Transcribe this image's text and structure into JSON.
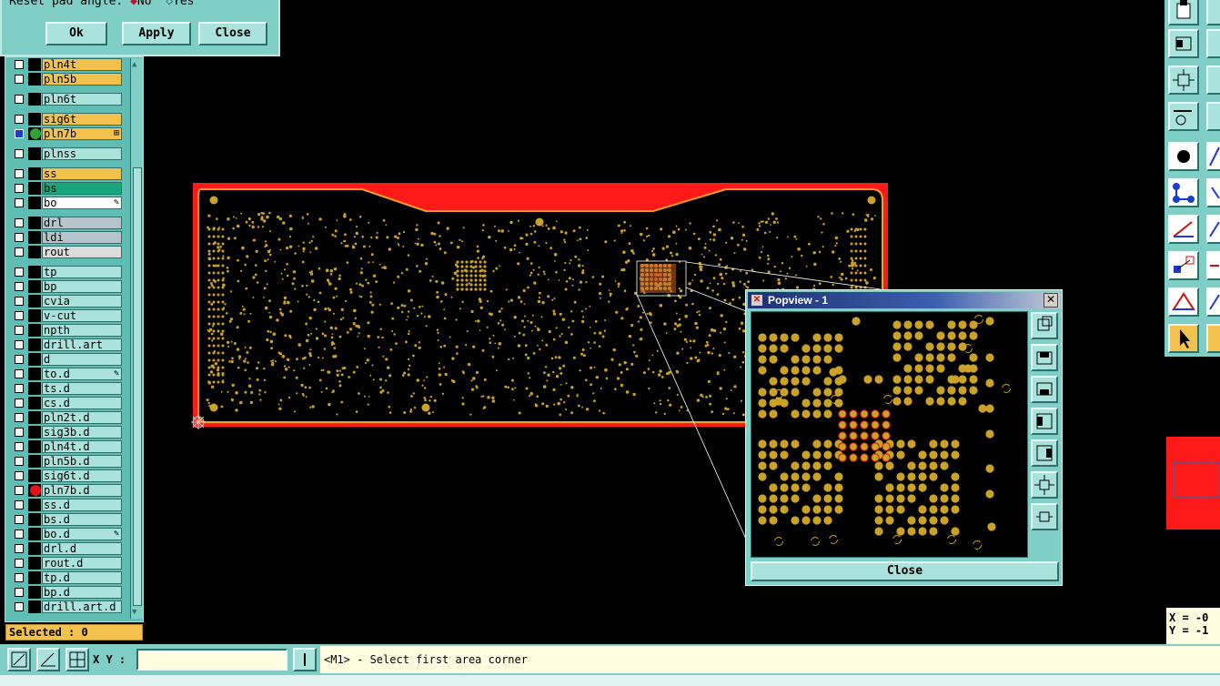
{
  "dialog": {
    "reset_label": "Reset pad angle:",
    "opt_no": "No",
    "opt_yes": "Yes",
    "ok": "Ok",
    "apply": "Apply",
    "close": "Close"
  },
  "layers": [
    {
      "name": "pln4t",
      "color": "#f2c14e"
    },
    {
      "name": "pln5b",
      "color": "#f2c14e"
    },
    {
      "name": "pln6t",
      "color": "#a9e3dc"
    },
    {
      "name": "sig6t",
      "color": "#f2c14e"
    },
    {
      "name": "pln7b",
      "color": "#f2c14e",
      "dot": "#2fa33a",
      "marker": "⊞",
      "checked": true
    },
    {
      "name": "plnss",
      "color": "#a9e3dc"
    },
    {
      "name": "ss",
      "color": "#f2c14e"
    },
    {
      "name": "bs",
      "color": "#1aa57c"
    },
    {
      "name": "bo",
      "color": "#ffffff",
      "marker": "✎"
    },
    {
      "name": "drl",
      "color": "#b7c4cc"
    },
    {
      "name": "ldi",
      "color": "#b7c4cc"
    },
    {
      "name": "rout",
      "color": "#dcdcdc"
    },
    {
      "name": "tp",
      "color": "#a9e3dc"
    },
    {
      "name": "bp",
      "color": "#a9e3dc"
    },
    {
      "name": "cvia",
      "color": "#a9e3dc"
    },
    {
      "name": "v-cut",
      "color": "#a9e3dc"
    },
    {
      "name": "npth",
      "color": "#a9e3dc"
    },
    {
      "name": "drill.art",
      "color": "#a9e3dc"
    },
    {
      "name": "d",
      "color": "#a9e3dc"
    },
    {
      "name": "to.d",
      "color": "#a9e3dc",
      "marker": "✎"
    },
    {
      "name": "ts.d",
      "color": "#a9e3dc"
    },
    {
      "name": "cs.d",
      "color": "#a9e3dc"
    },
    {
      "name": "pln2t.d",
      "color": "#a9e3dc"
    },
    {
      "name": "sig3b.d",
      "color": "#a9e3dc"
    },
    {
      "name": "pln4t.d",
      "color": "#a9e3dc"
    },
    {
      "name": "pln5b.d",
      "color": "#a9e3dc"
    },
    {
      "name": "sig6t.d",
      "color": "#a9e3dc"
    },
    {
      "name": "pln7b.d",
      "color": "#a9e3dc",
      "dot": "#e8101a"
    },
    {
      "name": "ss.d",
      "color": "#a9e3dc"
    },
    {
      "name": "bs.d",
      "color": "#a9e3dc"
    },
    {
      "name": "bo.d",
      "color": "#a9e3dc",
      "marker": "✎"
    },
    {
      "name": "drl.d",
      "color": "#a9e3dc"
    },
    {
      "name": "rout.d",
      "color": "#a9e3dc"
    },
    {
      "name": "tp.d",
      "color": "#a9e3dc"
    },
    {
      "name": "bp.d",
      "color": "#a9e3dc"
    },
    {
      "name": "drill.art.d",
      "color": "#a9e3dc"
    }
  ],
  "selected_label": "Selected : 0",
  "xy_label": "X Y :",
  "xy_value": "",
  "command_prompt": "<M1> - Select first area corner",
  "status_text": "",
  "coords": {
    "x": "X = -0",
    "y": "Y = -1"
  },
  "popview": {
    "title": "Popview - 1",
    "close": "Close"
  },
  "colors": {
    "ui_teal": "#7fcfc7",
    "board_red": "#ff1a1a",
    "pad_gold": "#c9a227",
    "orange_border": "#f2a02a"
  }
}
